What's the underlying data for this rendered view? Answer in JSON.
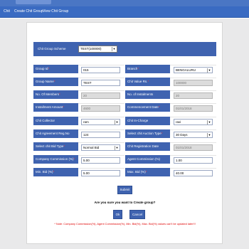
{
  "header": {
    "tab_label": ""
  },
  "menu": {
    "items": [
      "Chit",
      "Create Chit Group",
      "View Chit Group"
    ]
  },
  "scheme": {
    "label": "Chit Group Scheme",
    "value": "TEST(100000)"
  },
  "form": {
    "group_id": {
      "label": "Group Id",
      "req": "*",
      "value": "015"
    },
    "branch": {
      "label": "Branch",
      "req": "*",
      "value": "BENGALURU"
    },
    "group_name": {
      "label": "Group Name",
      "req": "*",
      "value": "TEST"
    },
    "chit_value": {
      "label": "Chit Value Rs.",
      "req": "*",
      "value": "100000"
    },
    "members": {
      "label": "No. Of Members",
      "req": "*",
      "value": "20"
    },
    "installments": {
      "label": "No. of Instalments",
      "req": "",
      "value": "20"
    },
    "installment_amount": {
      "label": "Installment Amount",
      "req": "*",
      "value": "4600"
    },
    "commencement_date": {
      "label": "Commencement Date",
      "req": "*",
      "value": "01/01/2018"
    },
    "collector": {
      "label": "Chit Collector",
      "req": "",
      "value": "ram"
    },
    "in_charge": {
      "label": "Chit In-Charge",
      "req": "",
      "value": "ravi"
    },
    "agreement_no": {
      "label": "Chit Agreement Reg.No",
      "req": "",
      "value": "124"
    },
    "auction_type": {
      "label": "Select chit Auction Type",
      "req": "*",
      "value": "30 Days"
    },
    "bid_type": {
      "label": "Select chit Bid Type",
      "req": "*",
      "value": "Normal Bid"
    },
    "registration_date": {
      "label": "Chit Registration Date",
      "req": "",
      "value": "01/01/2018"
    },
    "company_commission": {
      "label": "Company Commission (%)",
      "req": "*",
      "value": "5.00"
    },
    "agent_commission": {
      "label": "Agent Commission (%)",
      "req": "",
      "value": "1.00"
    },
    "min_bid": {
      "label": "Min. Bid (%)",
      "req": "*",
      "value": "5.00"
    },
    "max_bid": {
      "label": "Max. Bid (%)",
      "req": "*",
      "value": "40.00"
    }
  },
  "actions": {
    "submit": "Submit",
    "question": "Are you sure you want to Create group?",
    "ok": "Ok",
    "cancel": "Cancel",
    "note": "* Note: Company Commission(%), Agent Commission(%), Min. Bid(%), Max. Bid(%) values can't be updated later!!!"
  },
  "colors": {
    "header_blue": "#3a6bc2",
    "label_blue": "#3f63b0",
    "required_red": "#ff3b3b",
    "note_red": "#e00000",
    "page_gray": "#e9e9ea"
  }
}
